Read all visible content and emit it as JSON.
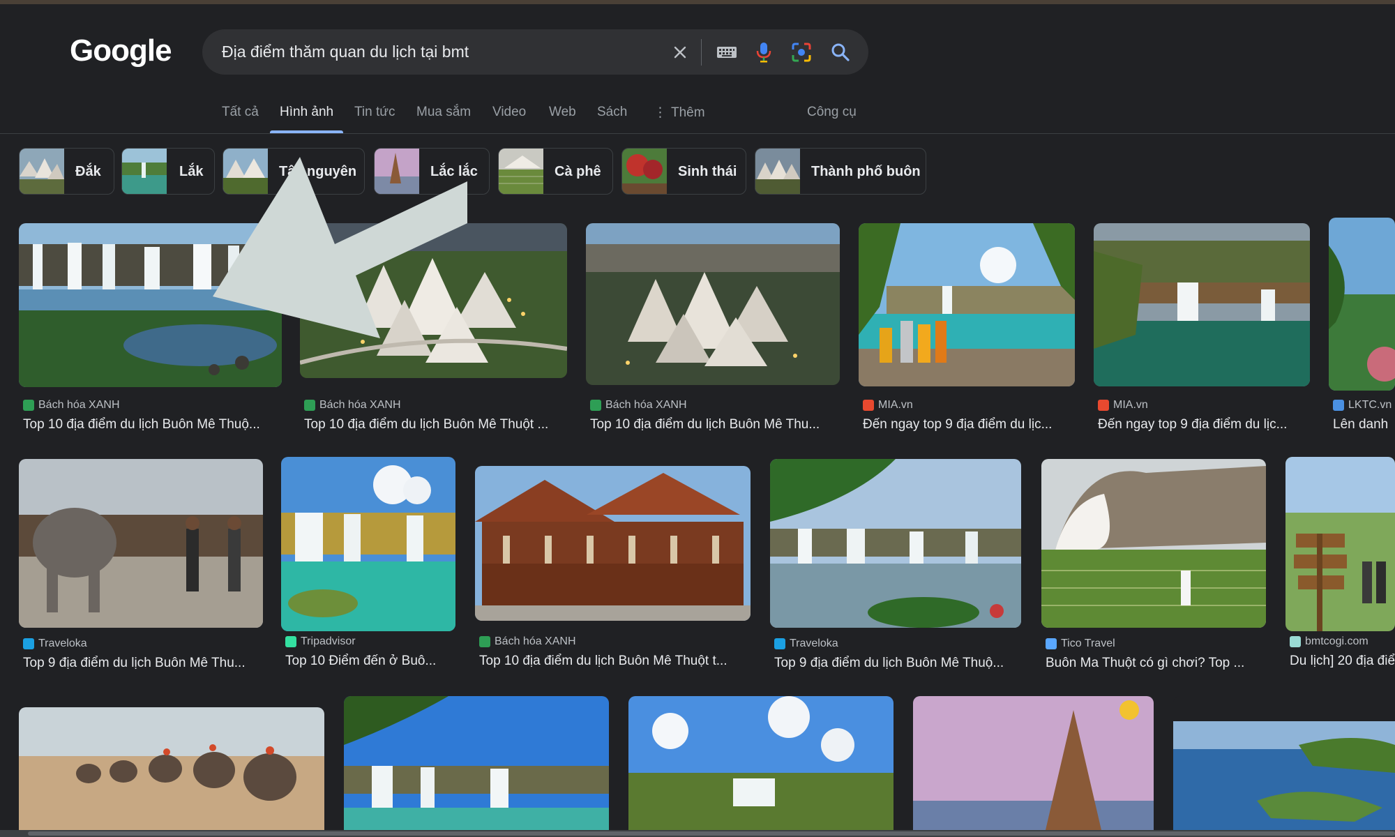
{
  "logo": {
    "text": "Google"
  },
  "search": {
    "query": "Địa điểm thăm quan du lịch tại bmt"
  },
  "tabs": [
    {
      "label": "Tất cả"
    },
    {
      "label": "Hình ảnh"
    },
    {
      "label": "Tin tức"
    },
    {
      "label": "Mua sắm"
    },
    {
      "label": "Video"
    },
    {
      "label": "Web"
    },
    {
      "label": "Sách"
    },
    {
      "label": "Thêm"
    },
    {
      "label": "Công cụ"
    }
  ],
  "chips": [
    {
      "label": "Đắk"
    },
    {
      "label": "Lắk"
    },
    {
      "label": "Tây nguyên"
    },
    {
      "label": "Lắc lắc"
    },
    {
      "label": "Cà phê"
    },
    {
      "label": "Sinh thái"
    },
    {
      "label": "Thành phố buôn"
    }
  ],
  "results_row1": [
    {
      "source": "Bách hóa XANH",
      "title": "Top 10 địa điểm du lịch Buôn Mê Thuộ..."
    },
    {
      "source": "Bách hóa XANH",
      "title": "Top 10 địa điểm du lịch Buôn Mê Thuột ..."
    },
    {
      "source": "Bách hóa XANH",
      "title": "Top 10 địa điểm du lịch Buôn Mê Thu..."
    },
    {
      "source": "MIA.vn",
      "title": "Đến ngay top 9 địa điểm du lịc..."
    },
    {
      "source": "MIA.vn",
      "title": "Đến ngay top 9 địa điểm du lịc..."
    },
    {
      "source": "LKTC.vn",
      "title": "Lên danh"
    }
  ],
  "results_row2": [
    {
      "source": "Traveloka",
      "title": "Top 9 địa điểm du lịch Buôn Mê Thu..."
    },
    {
      "source": "Tripadvisor",
      "title": "Top 10 Điểm đến ở Buô..."
    },
    {
      "source": "Bách hóa XANH",
      "title": "Top 10 địa điểm du lịch Buôn Mê Thuột t..."
    },
    {
      "source": "Traveloka",
      "title": "Top 9 địa điểm du lịch Buôn Mê Thuộ..."
    },
    {
      "source": "Tico Travel",
      "title": "Buôn Ma Thuột có gì chơi? Top ..."
    },
    {
      "source": "bmtcogi.com",
      "title": "Du lịch] 20 địa điể"
    }
  ],
  "icons": {
    "clear": "close-icon",
    "keyboard": "keyboard-icon",
    "voice": "microphone-icon",
    "lens": "lens-icon",
    "search": "search-icon",
    "more": "more-vert-icon"
  },
  "colors": {
    "background": "#202124",
    "searchbox": "#303134",
    "accent": "#8ab4f8",
    "overlay_arrow": "#cfd8d6"
  }
}
